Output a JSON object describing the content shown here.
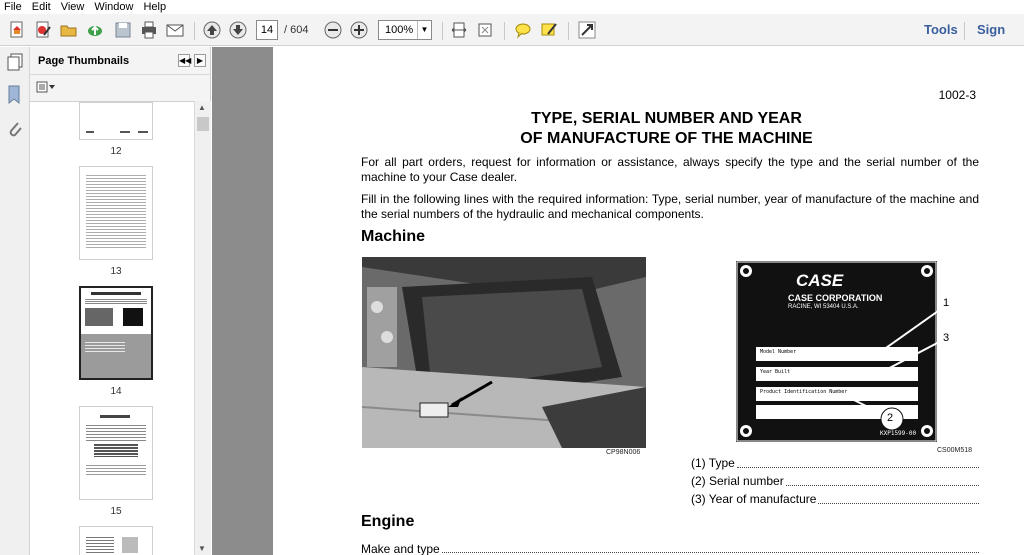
{
  "menu": [
    "File",
    "Edit",
    "View",
    "Window",
    "Help"
  ],
  "toolbar": {
    "current_page": "14",
    "page_total": "/ 604",
    "zoom": "100%",
    "tools_label": "Tools",
    "sign_label": "Sign"
  },
  "thumbnails": {
    "title": "Page Thumbnails",
    "pages": [
      "12",
      "13",
      "14",
      "15"
    ]
  },
  "document": {
    "page_number": "1002-3",
    "title_line1": "TYPE, SERIAL NUMBER AND YEAR",
    "title_line2": "OF MANUFACTURE OF THE MACHINE",
    "para1": "For all part orders, request for information or assistance, always specify the type and the serial number of the machine to your Case dealer.",
    "para2": "Fill in the following lines with the required information: Type, serial number, year of manufacture of the machine and the serial numbers of the hydraulic and mechanical components.",
    "heading_machine": "Machine",
    "photo_caption": "CP98N006",
    "plate_caption": "CS00M518",
    "plate": {
      "brand": "CASE",
      "corp": "CASE CORPORATION",
      "address": "RACINE, WI 53404 U.S.A.",
      "row1": "Model Number",
      "row2": "Year Built",
      "row3": "Product Identification Number",
      "code": "KXP1599-00",
      "callouts": [
        "1",
        "3",
        "2"
      ]
    },
    "fields": [
      "(1) Type",
      "(2) Serial number",
      "(3) Year of manufacture"
    ],
    "heading_engine": "Engine",
    "make_type": "Make and type"
  }
}
